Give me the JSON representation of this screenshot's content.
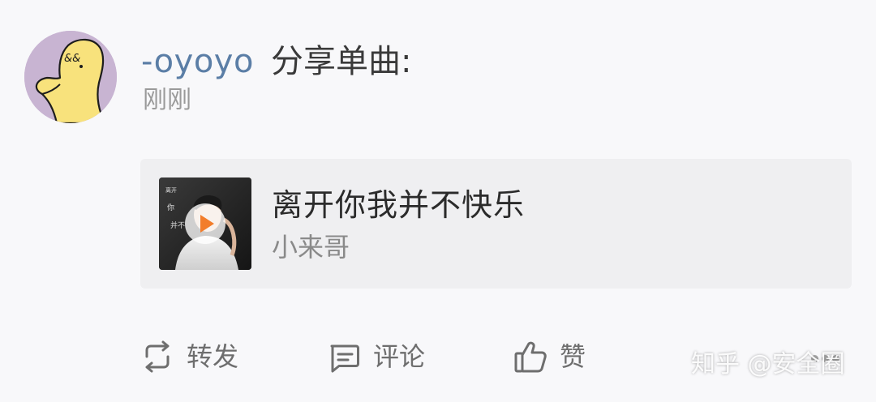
{
  "post": {
    "username": "-oyoyo",
    "share_label": "分享单曲:",
    "timestamp": "刚刚",
    "avatar_icon": "yellow-duck-avatar",
    "avatar_text": "&&"
  },
  "song": {
    "title": "离开你我并不快乐",
    "artist": "小来哥",
    "cover_icon": "album-cover",
    "play_icon": "play-icon"
  },
  "actions": {
    "repost": {
      "label": "转发",
      "icon": "repost-icon"
    },
    "comment": {
      "label": "评论",
      "icon": "comment-icon"
    },
    "like": {
      "label": "赞",
      "icon": "thumbs-up-icon"
    },
    "more_icon": "more-dots-icon"
  },
  "watermark": "知乎 @安全圈",
  "colors": {
    "background": "#f8f8fa",
    "username": "#5b7ea6",
    "card": "#efeff1",
    "play_accent": "#f27d2b",
    "avatar_bg": "#c8b4d2",
    "avatar_duck": "#f8e27c"
  }
}
